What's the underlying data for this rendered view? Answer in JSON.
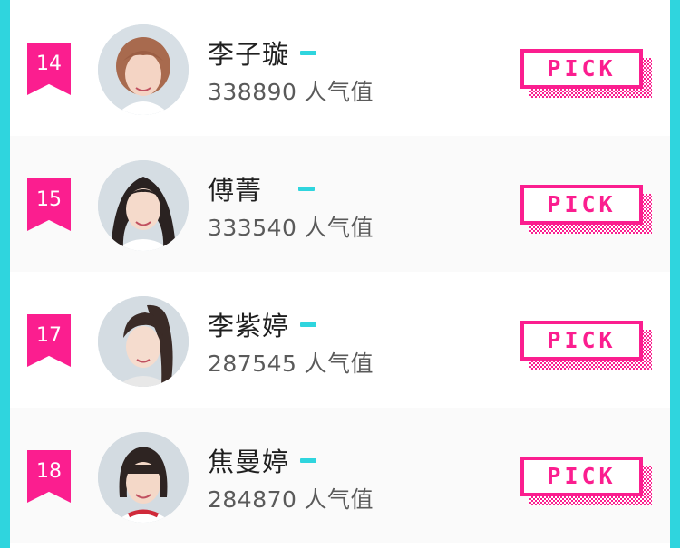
{
  "colors": {
    "frame": "#2fd5de",
    "accent_pink": "#fb1e8f",
    "trend_flat": "#2fd5de"
  },
  "ranking": [
    {
      "rank": "14",
      "name": "李子璇",
      "votes": "338890",
      "votes_label": "人气值",
      "trend": "flat",
      "pick_label": "PICK"
    },
    {
      "rank": "15",
      "name": "傅菁",
      "votes": "333540",
      "votes_label": "人气值",
      "trend": "flat",
      "pick_label": "PICK"
    },
    {
      "rank": "17",
      "name": "李紫婷",
      "votes": "287545",
      "votes_label": "人气值",
      "trend": "flat",
      "pick_label": "PICK"
    },
    {
      "rank": "18",
      "name": "焦曼婷",
      "votes": "284870",
      "votes_label": "人气值",
      "trend": "flat",
      "pick_label": "PICK"
    }
  ]
}
